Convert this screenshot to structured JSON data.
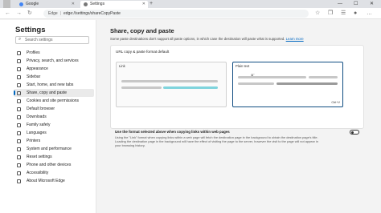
{
  "browser": {
    "tabs": [
      {
        "label": "Google",
        "active": false,
        "favicon_color": "#4285f4"
      },
      {
        "label": "Settings",
        "active": true,
        "favicon_color": "#777777"
      }
    ],
    "newtab_icon": "+",
    "window_controls": [
      "—",
      "☐",
      "✕"
    ],
    "address": {
      "origin": "Edge",
      "separator": "|",
      "url": "edge://settings/shareCopyPaste"
    }
  },
  "sidebar": {
    "title": "Settings",
    "search_placeholder": "Search settings",
    "items": [
      {
        "label": "Profiles",
        "icon": "profile-icon"
      },
      {
        "label": "Privacy, search, and services",
        "icon": "lock-icon"
      },
      {
        "label": "Appearance",
        "icon": "appearance-icon"
      },
      {
        "label": "Sidebar",
        "icon": "sidebar-icon"
      },
      {
        "label": "Start, home, and new tabs",
        "icon": "home-icon"
      },
      {
        "label": "Share, copy and paste",
        "icon": "share-icon",
        "selected": true
      },
      {
        "label": "Cookies and site permissions",
        "icon": "cookie-icon"
      },
      {
        "label": "Default browser",
        "icon": "browser-icon"
      },
      {
        "label": "Downloads",
        "icon": "download-icon"
      },
      {
        "label": "Family safety",
        "icon": "family-icon"
      },
      {
        "label": "Languages",
        "icon": "language-icon"
      },
      {
        "label": "Printers",
        "icon": "printer-icon"
      },
      {
        "label": "System and performance",
        "icon": "system-icon"
      },
      {
        "label": "Reset settings",
        "icon": "reset-icon"
      },
      {
        "label": "Phone and other devices",
        "icon": "phone-icon"
      },
      {
        "label": "Accessibility",
        "icon": "accessibility-icon"
      },
      {
        "label": "About Microsoft Edge",
        "icon": "edge-icon"
      }
    ]
  },
  "main": {
    "title": "Share, copy and paste",
    "description": "Some paste destinations don't support all paste options, in which case the destination will paste what is supported.",
    "learn_more": "Learn more",
    "format_card": {
      "heading": "URL copy & paste format default",
      "options": [
        {
          "label": "Link",
          "selected": false
        },
        {
          "label": "Plain text",
          "selected": true,
          "shortcut": "Ctrl+V"
        }
      ]
    },
    "toggle": {
      "label": "Use the format selected above when copying links within web pages",
      "description": "Using the \"Link\" format when copying links within a web page will fetch the destination page in the background to obtain the destination page's title. Loading the destination page in the background will have the effect of visiting the page to the server, however the visit to the page will not appear in your browsing history.",
      "enabled": false
    }
  },
  "colors": {
    "accent": "#0067c0",
    "selected_border": "#0f4c81",
    "teal_bar": "#7fd4dd"
  }
}
